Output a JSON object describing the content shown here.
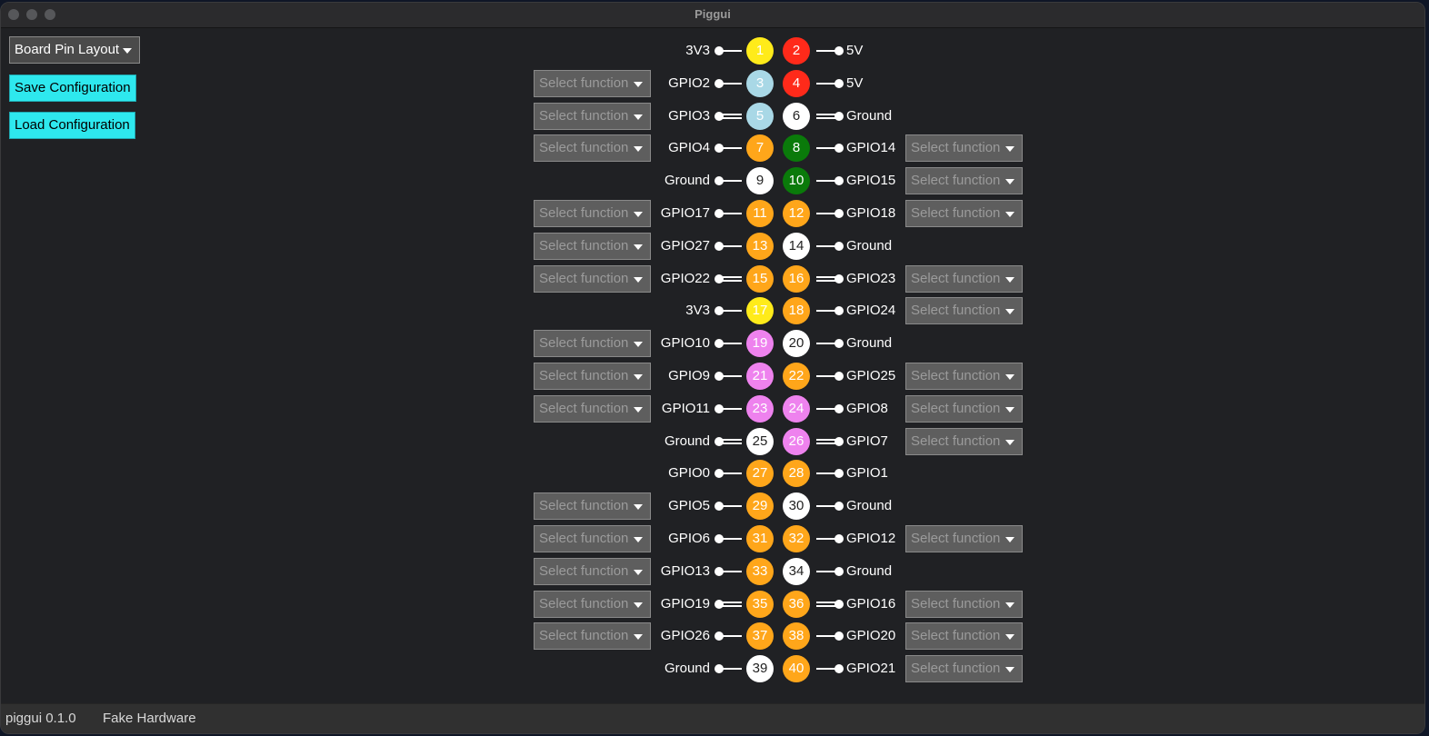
{
  "window": {
    "title": "Piggui"
  },
  "sidebar": {
    "layout_select": "Board Pin Layout",
    "save_label": "Save Configuration",
    "load_label": "Load Configuration"
  },
  "select_placeholder": "Select function",
  "colors": {
    "yellow": "#ffeb1a",
    "red": "#ff2a1a",
    "lightblue": "#a9d8e6",
    "white": "#ffffff",
    "green": "#0a7a0a",
    "orange": "#ffa61a",
    "violet": "#ee82ee",
    "accent_cyan": "#2ee8ee"
  },
  "pin_rows": [
    {
      "left": {
        "num": "1",
        "label": "3V3",
        "color": "yellow",
        "select": false
      },
      "right": {
        "num": "2",
        "label": "5V",
        "color": "red",
        "select": false
      }
    },
    {
      "left": {
        "num": "3",
        "label": "GPIO2",
        "color": "lightblue",
        "select": true
      },
      "right": {
        "num": "4",
        "label": "5V",
        "color": "red",
        "select": false
      }
    },
    {
      "left": {
        "num": "5",
        "label": "GPIO3",
        "color": "lightblue",
        "select": true
      },
      "right": {
        "num": "6",
        "label": "Ground",
        "color": "white",
        "select": false
      }
    },
    {
      "left": {
        "num": "7",
        "label": "GPIO4",
        "color": "orange",
        "select": true
      },
      "right": {
        "num": "8",
        "label": "GPIO14",
        "color": "green",
        "select": true
      }
    },
    {
      "left": {
        "num": "9",
        "label": "Ground",
        "color": "white",
        "select": false
      },
      "right": {
        "num": "10",
        "label": "GPIO15",
        "color": "green",
        "select": true
      }
    },
    {
      "left": {
        "num": "11",
        "label": "GPIO17",
        "color": "orange",
        "select": true
      },
      "right": {
        "num": "12",
        "label": "GPIO18",
        "color": "orange",
        "select": true
      }
    },
    {
      "left": {
        "num": "13",
        "label": "GPIO27",
        "color": "orange",
        "select": true
      },
      "right": {
        "num": "14",
        "label": "Ground",
        "color": "white",
        "select": false
      }
    },
    {
      "left": {
        "num": "15",
        "label": "GPIO22",
        "color": "orange",
        "select": true
      },
      "right": {
        "num": "16",
        "label": "GPIO23",
        "color": "orange",
        "select": true
      }
    },
    {
      "left": {
        "num": "17",
        "label": "3V3",
        "color": "yellow",
        "select": false
      },
      "right": {
        "num": "18",
        "label": "GPIO24",
        "color": "orange",
        "select": true
      }
    },
    {
      "left": {
        "num": "19",
        "label": "GPIO10",
        "color": "violet",
        "select": true
      },
      "right": {
        "num": "20",
        "label": "Ground",
        "color": "white",
        "select": false
      }
    },
    {
      "left": {
        "num": "21",
        "label": "GPIO9",
        "color": "violet",
        "select": true
      },
      "right": {
        "num": "22",
        "label": "GPIO25",
        "color": "orange",
        "select": true
      }
    },
    {
      "left": {
        "num": "23",
        "label": "GPIO11",
        "color": "violet",
        "select": true
      },
      "right": {
        "num": "24",
        "label": "GPIO8",
        "color": "violet",
        "select": true
      }
    },
    {
      "left": {
        "num": "25",
        "label": "Ground",
        "color": "white",
        "select": false
      },
      "right": {
        "num": "26",
        "label": "GPIO7",
        "color": "violet",
        "select": true
      }
    },
    {
      "left": {
        "num": "27",
        "label": "GPIO0",
        "color": "orange",
        "select": false
      },
      "right": {
        "num": "28",
        "label": "GPIO1",
        "color": "orange",
        "select": false
      }
    },
    {
      "left": {
        "num": "29",
        "label": "GPIO5",
        "color": "orange",
        "select": true
      },
      "right": {
        "num": "30",
        "label": "Ground",
        "color": "white",
        "select": false
      }
    },
    {
      "left": {
        "num": "31",
        "label": "GPIO6",
        "color": "orange",
        "select": true
      },
      "right": {
        "num": "32",
        "label": "GPIO12",
        "color": "orange",
        "select": true
      }
    },
    {
      "left": {
        "num": "33",
        "label": "GPIO13",
        "color": "orange",
        "select": true
      },
      "right": {
        "num": "34",
        "label": "Ground",
        "color": "white",
        "select": false
      }
    },
    {
      "left": {
        "num": "35",
        "label": "GPIO19",
        "color": "orange",
        "select": true
      },
      "right": {
        "num": "36",
        "label": "GPIO16",
        "color": "orange",
        "select": true
      }
    },
    {
      "left": {
        "num": "37",
        "label": "GPIO26",
        "color": "orange",
        "select": true
      },
      "right": {
        "num": "38",
        "label": "GPIO20",
        "color": "orange",
        "select": true
      }
    },
    {
      "left": {
        "num": "39",
        "label": "Ground",
        "color": "white",
        "select": false
      },
      "right": {
        "num": "40",
        "label": "GPIO21",
        "color": "orange",
        "select": true
      }
    }
  ],
  "status": {
    "version": "piggui 0.1.0",
    "hardware": "Fake Hardware"
  }
}
